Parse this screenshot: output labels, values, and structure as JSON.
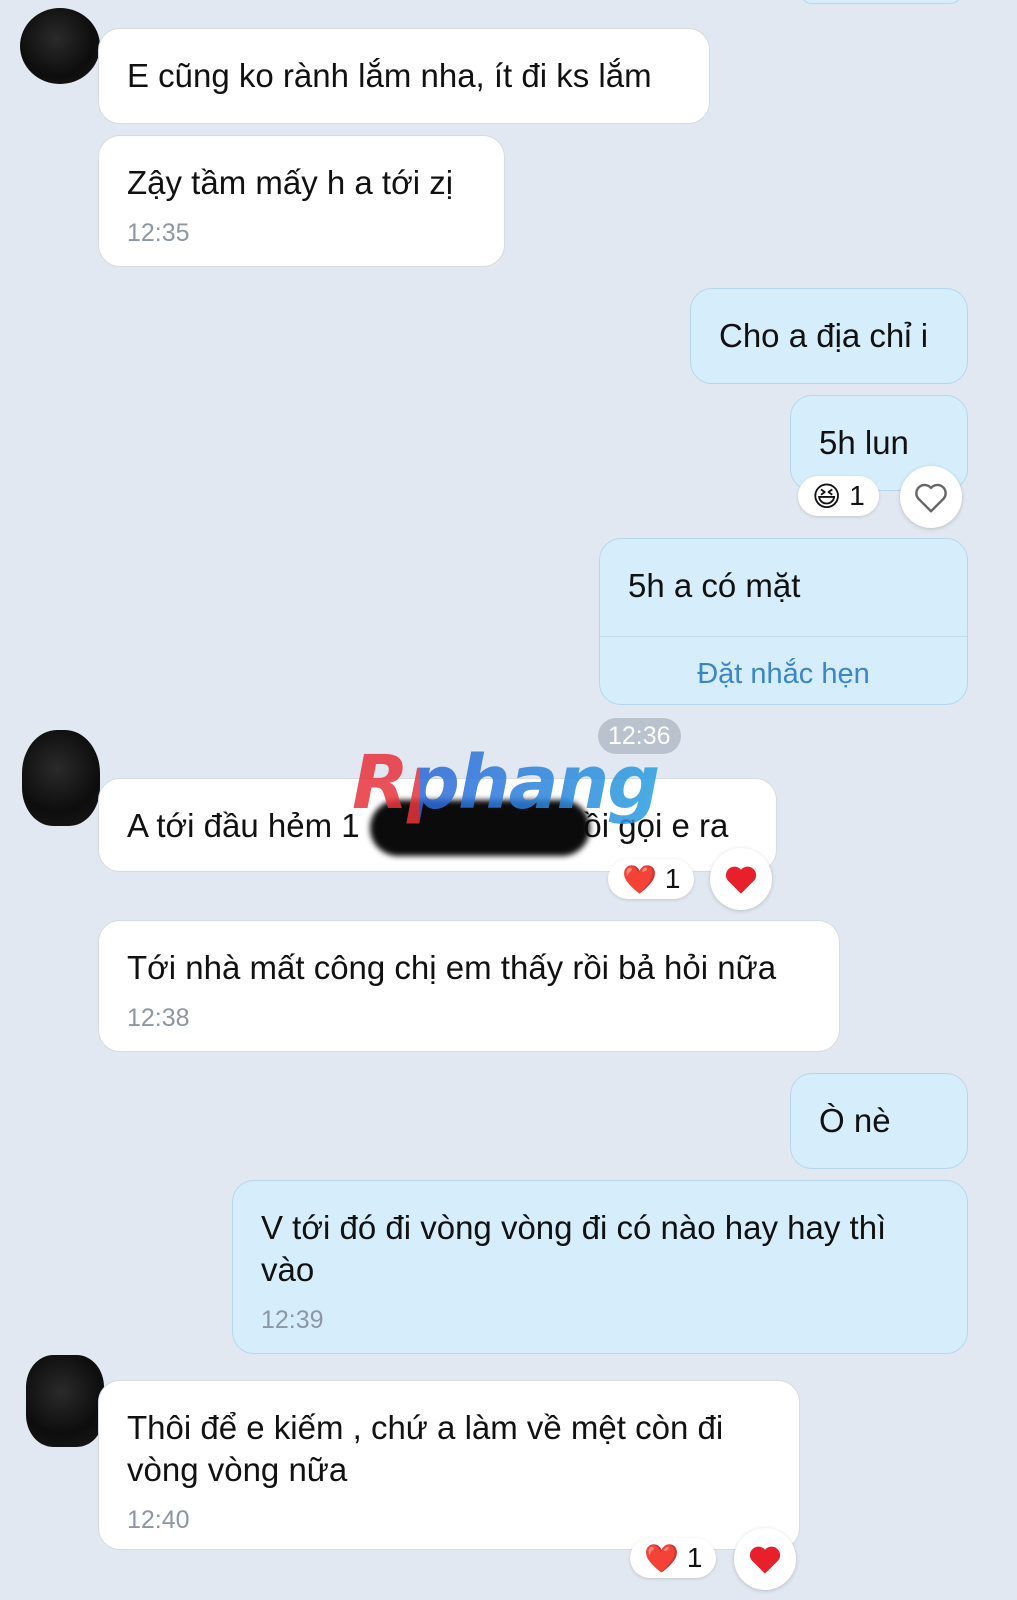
{
  "messages": [
    {
      "text": "E cũng ko rành lắm nha, ít đi ks lắm"
    },
    {
      "text": "Zậy tầm mấy h a tới zị",
      "time": "12:35"
    },
    {
      "text": "Cho a địa chỉ i"
    },
    {
      "text": "5h lun",
      "reaction": {
        "emoji": "😆",
        "count": "1"
      }
    },
    {
      "text": "5h a có mặt",
      "action": "Đặt nhắc hẹn"
    },
    {
      "time_divider": "12:36"
    },
    {
      "text": "A tới đầu hẻm 1",
      "text_tail": "ức tho rồi gọi e ra",
      "reaction": {
        "emoji": "❤️",
        "count": "1"
      }
    },
    {
      "text": "Tới nhà mất công chị em thấy rồi bả hỏi nữa",
      "time": "12:38"
    },
    {
      "text": "Ò nè"
    },
    {
      "text": "V tới đó đi vòng vòng đi có nào hay hay thì vào",
      "time": "12:39"
    },
    {
      "text": "Thôi để e kiếm , chứ a làm về mệt còn đi vòng vòng nữa",
      "time": "12:40",
      "reaction": {
        "emoji": "❤️",
        "count": "1"
      }
    }
  ],
  "watermark": "Rphang",
  "icons": {
    "heart_outline": "heart-outline-icon",
    "heart_filled": "heart-icon"
  },
  "colors": {
    "incoming": "#ffffff",
    "outgoing": "#d6eefb",
    "link": "#3a86c8",
    "background": "#e2e8f1"
  }
}
